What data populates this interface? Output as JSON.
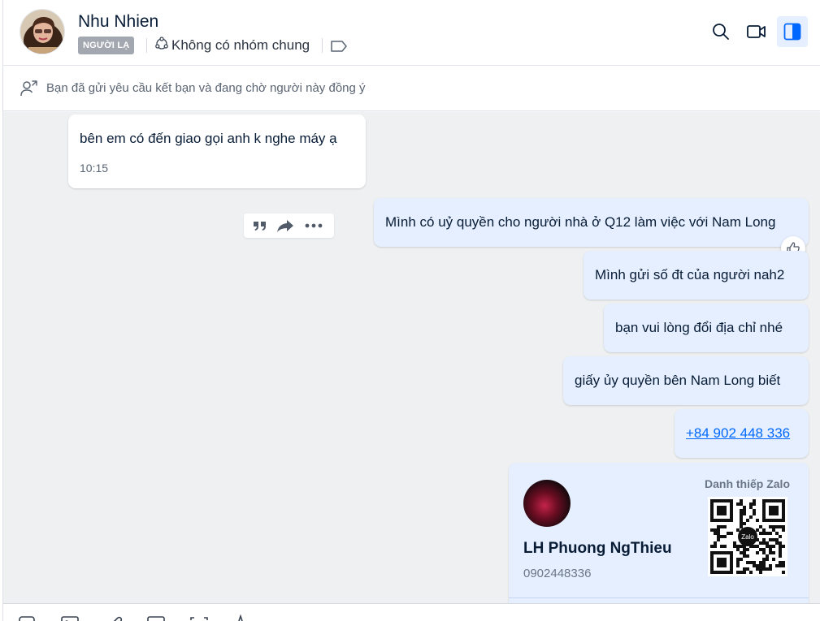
{
  "header": {
    "contact_name": "Nhu Nhien",
    "badge": "NGƯỜI LẠ",
    "group_text": "Không có nhóm chung"
  },
  "friend_request": {
    "text": "Bạn đã gửi yêu cầu kết bạn và đang chờ người này đồng ý"
  },
  "messages": [
    {
      "direction": "in",
      "text": "bên em có đến giao gọi anh k nghe máy ạ",
      "time": "10:15"
    },
    {
      "direction": "out",
      "text": "Mình có uỷ quyền cho người nhà ở Q12 làm việc với Nam Long"
    },
    {
      "direction": "out",
      "text": "Mình gửi số đt của người nah2"
    },
    {
      "direction": "out",
      "text": "bạn vui lòng đổi địa chỉ nhé"
    },
    {
      "direction": "out",
      "text": "giấy ủy quyền bên Nam Long biết"
    },
    {
      "direction": "out",
      "text": "+84 902 448 336",
      "is_link": true
    }
  ],
  "contact_card": {
    "title": "Danh thiếp Zalo",
    "name": "LH Phuong NgThieu",
    "phone": "0902448336",
    "qr_logo": "Zalo"
  },
  "colors": {
    "accent": "#0068ff",
    "outgoing_bubble": "#e5efff",
    "incoming_bubble": "#ffffff",
    "chat_background": "#eef0f2"
  },
  "icons": [
    "group-icon",
    "tag-icon",
    "search-icon",
    "video-call-icon",
    "sidebar-toggle-icon",
    "add-friend-icon",
    "quote-icon",
    "forward-icon",
    "more-icon",
    "like-icon"
  ]
}
